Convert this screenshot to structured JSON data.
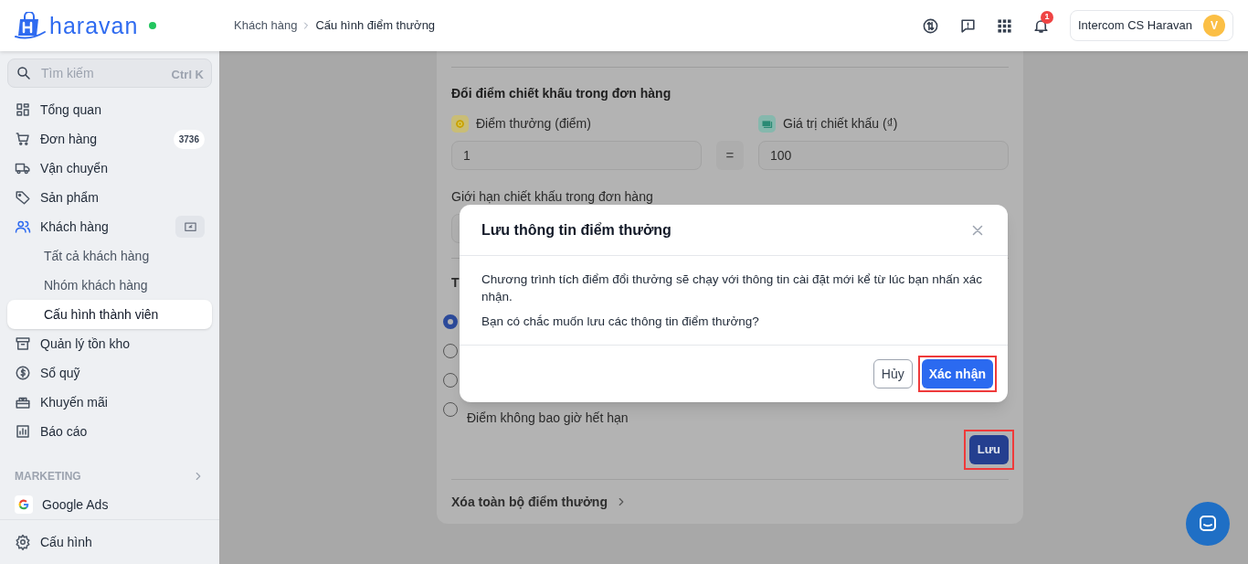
{
  "header": {
    "logo": "haravan",
    "online": true,
    "breadcrumb": [
      {
        "label": "Khách hàng"
      },
      {
        "label": "Cấu hình điểm thưởng"
      }
    ],
    "notification_count": "1",
    "account": {
      "name": "Intercom CS Haravan",
      "initial": "V"
    }
  },
  "sidebar": {
    "search": {
      "placeholder": "Tìm kiếm",
      "shortcut": "Ctrl K"
    },
    "items": [
      {
        "label": "Tổng quan",
        "selected": false
      },
      {
        "label": "Đơn hàng",
        "badge": "3736",
        "selected": false
      },
      {
        "label": "Vận chuyển",
        "selected": false
      },
      {
        "label": "Sản phẩm",
        "selected": false
      },
      {
        "label": "Khách hàng",
        "selected": false,
        "expanded": true,
        "children": [
          {
            "label": "Tất cả khách hàng",
            "selected": false
          },
          {
            "label": "Nhóm khách hàng",
            "selected": false
          },
          {
            "label": "Cấu hình thành viên",
            "selected": true
          }
        ]
      },
      {
        "label": "Quản lý tồn kho",
        "selected": false
      },
      {
        "label": "Sổ quỹ",
        "selected": false
      },
      {
        "label": "Khuyến mãi",
        "selected": false
      },
      {
        "label": "Báo cáo",
        "selected": false
      }
    ],
    "section": {
      "title": "MARKETING",
      "items": [
        {
          "label": "Google Ads",
          "selected": false
        }
      ]
    },
    "footer_item": {
      "label": "Cấu hình",
      "selected": false
    }
  },
  "main": {
    "section_title": "Đổi điểm chiết khấu trong đơn hàng",
    "fields": [
      {
        "label": "Điểm thưởng (điểm)",
        "value": "1"
      },
      {
        "label": "Giá trị chiết khấu (₫)",
        "value": "100"
      }
    ],
    "separator": "=",
    "limit_label": "Giới hạn chiết khấu trong đơn hàng",
    "expiry_heading": "T",
    "expiry_options": [
      {
        "selected": true
      },
      {
        "selected": false
      },
      {
        "selected": false
      },
      {
        "label": "Điểm không bao giờ hết hạn",
        "selected": false
      }
    ],
    "save_button": {
      "label": "Lưu",
      "highlighted": true
    },
    "reset_link": "Xóa toàn bộ điểm thưởng"
  },
  "dialog": {
    "title": "Lưu thông tin điểm thưởng",
    "paragraphs": [
      "Chương trình tích điểm đổi thưởng sẽ chạy với thông tin cài đặt mới kể từ lúc bạn nhấn xác nhận.",
      "Bạn có chắc muốn lưu các thông tin điểm thưởng?"
    ],
    "buttons": [
      {
        "label": "Hủy",
        "kind": "secondary",
        "highlighted": false
      },
      {
        "label": "Xác nhận",
        "kind": "primary",
        "highlighted": true
      }
    ]
  }
}
